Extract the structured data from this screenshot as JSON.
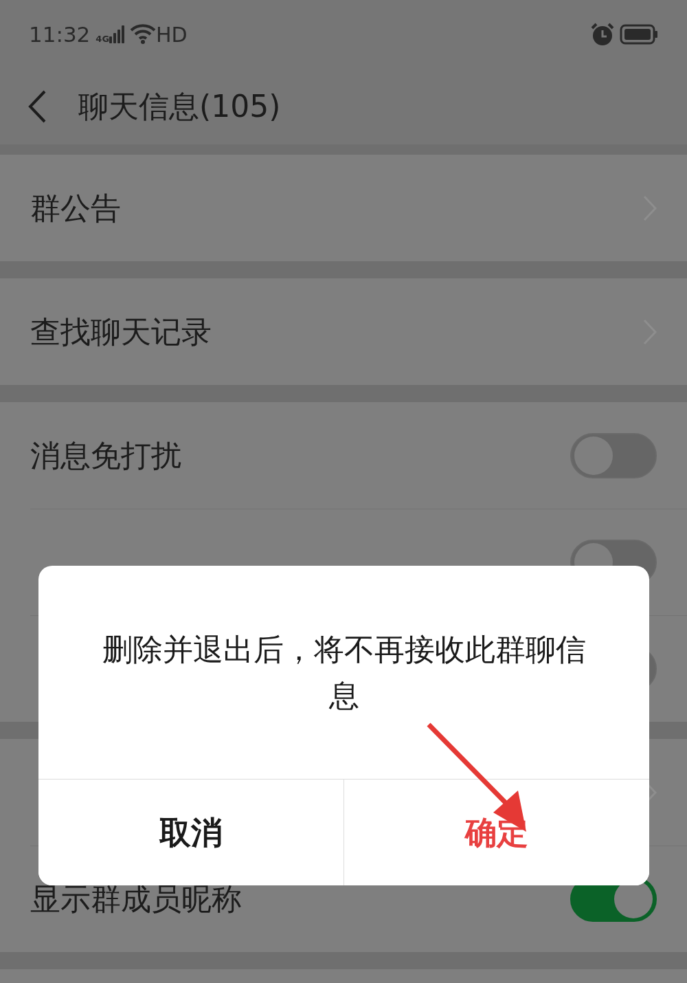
{
  "status_bar": {
    "time": "11:32",
    "network": "4G",
    "wifi_label": "HD"
  },
  "header": {
    "title": "聊天信息(105)"
  },
  "groups": [
    {
      "items": [
        {
          "kind": "link",
          "label": "群公告"
        }
      ]
    },
    {
      "items": [
        {
          "kind": "link",
          "label": "查找聊天记录"
        }
      ]
    },
    {
      "items": [
        {
          "kind": "toggle",
          "label": "消息免打扰",
          "on": false
        },
        {
          "kind": "toggle",
          "on": false
        },
        {
          "kind": "toggle",
          "on": false
        }
      ]
    },
    {
      "items": [
        {
          "kind": "link"
        },
        {
          "kind": "toggle",
          "label": "显示群成员昵称",
          "on": true
        }
      ]
    }
  ],
  "dialog": {
    "message": "删除并退出后，将不再接收此群聊信息",
    "buttons": [
      {
        "kind": "cancel",
        "label": "取消"
      },
      {
        "kind": "confirm",
        "label": "确定"
      }
    ]
  }
}
